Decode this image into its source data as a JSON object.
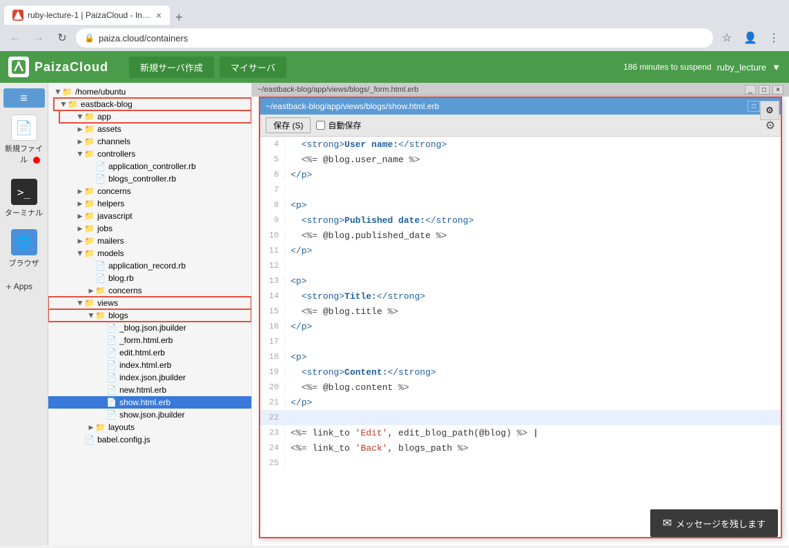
{
  "browser": {
    "tab_title": "ruby-lecture-1 | PaizaCloud - Ins...",
    "address": "paiza.cloud/containers",
    "new_tab_label": "+",
    "back_disabled": false,
    "forward_disabled": true
  },
  "paiza_header": {
    "logo_text": "PaizaCloud",
    "nav": [
      "新規サーバ作成",
      "マイサーバ"
    ],
    "user": "ruby_lecture",
    "suspend_info": "186 minutes to suspend"
  },
  "sidebar": {
    "new_file_label": "新規ファイル",
    "terminal_label": "ターミナル",
    "browser_label": "ブラウザ",
    "apps_label": "Apps"
  },
  "file_tree": {
    "root": "/home/ubuntu",
    "items": [
      {
        "id": "eastback-blog",
        "label": "eastback-blog",
        "type": "folder",
        "indent": 1,
        "expanded": true,
        "highlighted": true
      },
      {
        "id": "app",
        "label": "app",
        "type": "folder",
        "indent": 2,
        "expanded": true,
        "highlighted": true
      },
      {
        "id": "assets",
        "label": "assets",
        "type": "folder",
        "indent": 3,
        "expanded": false
      },
      {
        "id": "channels",
        "label": "channels",
        "type": "folder",
        "indent": 3,
        "expanded": false
      },
      {
        "id": "controllers",
        "label": "controllers",
        "type": "folder",
        "indent": 3,
        "expanded": true
      },
      {
        "id": "application_controller",
        "label": "application_controller.rb",
        "type": "file",
        "indent": 4
      },
      {
        "id": "blogs_controller",
        "label": "blogs_controller.rb",
        "type": "file",
        "indent": 4
      },
      {
        "id": "concerns",
        "label": "concerns",
        "type": "folder",
        "indent": 3,
        "expanded": false
      },
      {
        "id": "helpers",
        "label": "helpers",
        "type": "folder",
        "indent": 3,
        "expanded": false
      },
      {
        "id": "javascript",
        "label": "javascript",
        "type": "folder",
        "indent": 3,
        "expanded": false
      },
      {
        "id": "jobs",
        "label": "jobs",
        "type": "folder",
        "indent": 3,
        "expanded": false
      },
      {
        "id": "mailers",
        "label": "mailers",
        "type": "folder",
        "indent": 3,
        "expanded": false
      },
      {
        "id": "models",
        "label": "models",
        "type": "folder",
        "indent": 3,
        "expanded": true
      },
      {
        "id": "application_record",
        "label": "application_record.rb",
        "type": "file",
        "indent": 4
      },
      {
        "id": "blog",
        "label": "blog.rb",
        "type": "file",
        "indent": 4
      },
      {
        "id": "concerns2",
        "label": "concerns",
        "type": "folder",
        "indent": 4,
        "expanded": false
      },
      {
        "id": "views",
        "label": "views",
        "type": "folder",
        "indent": 3,
        "expanded": true,
        "highlighted": true
      },
      {
        "id": "blogs",
        "label": "blogs",
        "type": "folder",
        "indent": 4,
        "expanded": true,
        "highlighted": true
      },
      {
        "id": "blog_json_jbuilder",
        "label": "_blog.json.jbuilder",
        "type": "file",
        "indent": 5
      },
      {
        "id": "form_html_erb",
        "label": "_form.html.erb",
        "type": "file",
        "indent": 5
      },
      {
        "id": "edit_html_erb",
        "label": "edit.html.erb",
        "type": "file",
        "indent": 5
      },
      {
        "id": "index_html_erb",
        "label": "index.html.erb",
        "type": "file",
        "indent": 5
      },
      {
        "id": "index_json_jbuilder",
        "label": "index.json.jbuilder",
        "type": "file",
        "indent": 5
      },
      {
        "id": "new_html_erb",
        "label": "new.html.erb",
        "type": "file",
        "indent": 5
      },
      {
        "id": "show_html_erb",
        "label": "show.html.erb",
        "type": "file",
        "indent": 5,
        "selected": true
      },
      {
        "id": "show_json_jbuilder",
        "label": "show.json.jbuilder",
        "type": "file",
        "indent": 5
      },
      {
        "id": "layouts",
        "label": "layouts",
        "type": "folder",
        "indent": 4,
        "expanded": false
      },
      {
        "id": "babel_config",
        "label": "babel.config.js",
        "type": "file",
        "indent": 3
      }
    ]
  },
  "bg_editor": {
    "title": "~/eastback-blog/app/views/blogs/_form.html.erb"
  },
  "fg_editor": {
    "title": "~/eastback-blog/app/views/blogs/show.html.erb",
    "save_label": "保存 (S)",
    "autosave_label": "自動保存",
    "lines": [
      {
        "num": 4,
        "content": "  <strong>User name:</strong>",
        "type": "html"
      },
      {
        "num": 5,
        "content": "  <%= @blog.user_name %>",
        "type": "erb"
      },
      {
        "num": 6,
        "content": "</p>",
        "type": "html"
      },
      {
        "num": 7,
        "content": "",
        "type": "blank"
      },
      {
        "num": 8,
        "content": "<p>",
        "type": "html"
      },
      {
        "num": 9,
        "content": "  <strong>Published date:</strong>",
        "type": "html"
      },
      {
        "num": 10,
        "content": "  <%= @blog.published_date %>",
        "type": "erb"
      },
      {
        "num": 11,
        "content": "</p>",
        "type": "html"
      },
      {
        "num": 12,
        "content": "",
        "type": "blank"
      },
      {
        "num": 13,
        "content": "<p>",
        "type": "html"
      },
      {
        "num": 14,
        "content": "  <strong>Title:</strong>",
        "type": "html"
      },
      {
        "num": 15,
        "content": "  <%= @blog.title %>",
        "type": "erb"
      },
      {
        "num": 16,
        "content": "</p>",
        "type": "html"
      },
      {
        "num": 17,
        "content": "",
        "type": "blank"
      },
      {
        "num": 18,
        "content": "<p>",
        "type": "html"
      },
      {
        "num": 19,
        "content": "  <strong>Content:</strong>",
        "type": "html"
      },
      {
        "num": 20,
        "content": "  <%= @blog.content %>",
        "type": "erb"
      },
      {
        "num": 21,
        "content": "</p>",
        "type": "html"
      },
      {
        "num": 22,
        "content": "",
        "type": "current"
      },
      {
        "num": 23,
        "content": "<%= link_to 'Edit', edit_blog_path(@blog) %> |",
        "type": "erb"
      },
      {
        "num": 24,
        "content": "<%= link_to 'Back', blogs_path %>",
        "type": "erb"
      },
      {
        "num": 25,
        "content": "",
        "type": "blank"
      }
    ]
  },
  "message_btn": {
    "label": "メッセージを残します",
    "icon": "✉"
  }
}
